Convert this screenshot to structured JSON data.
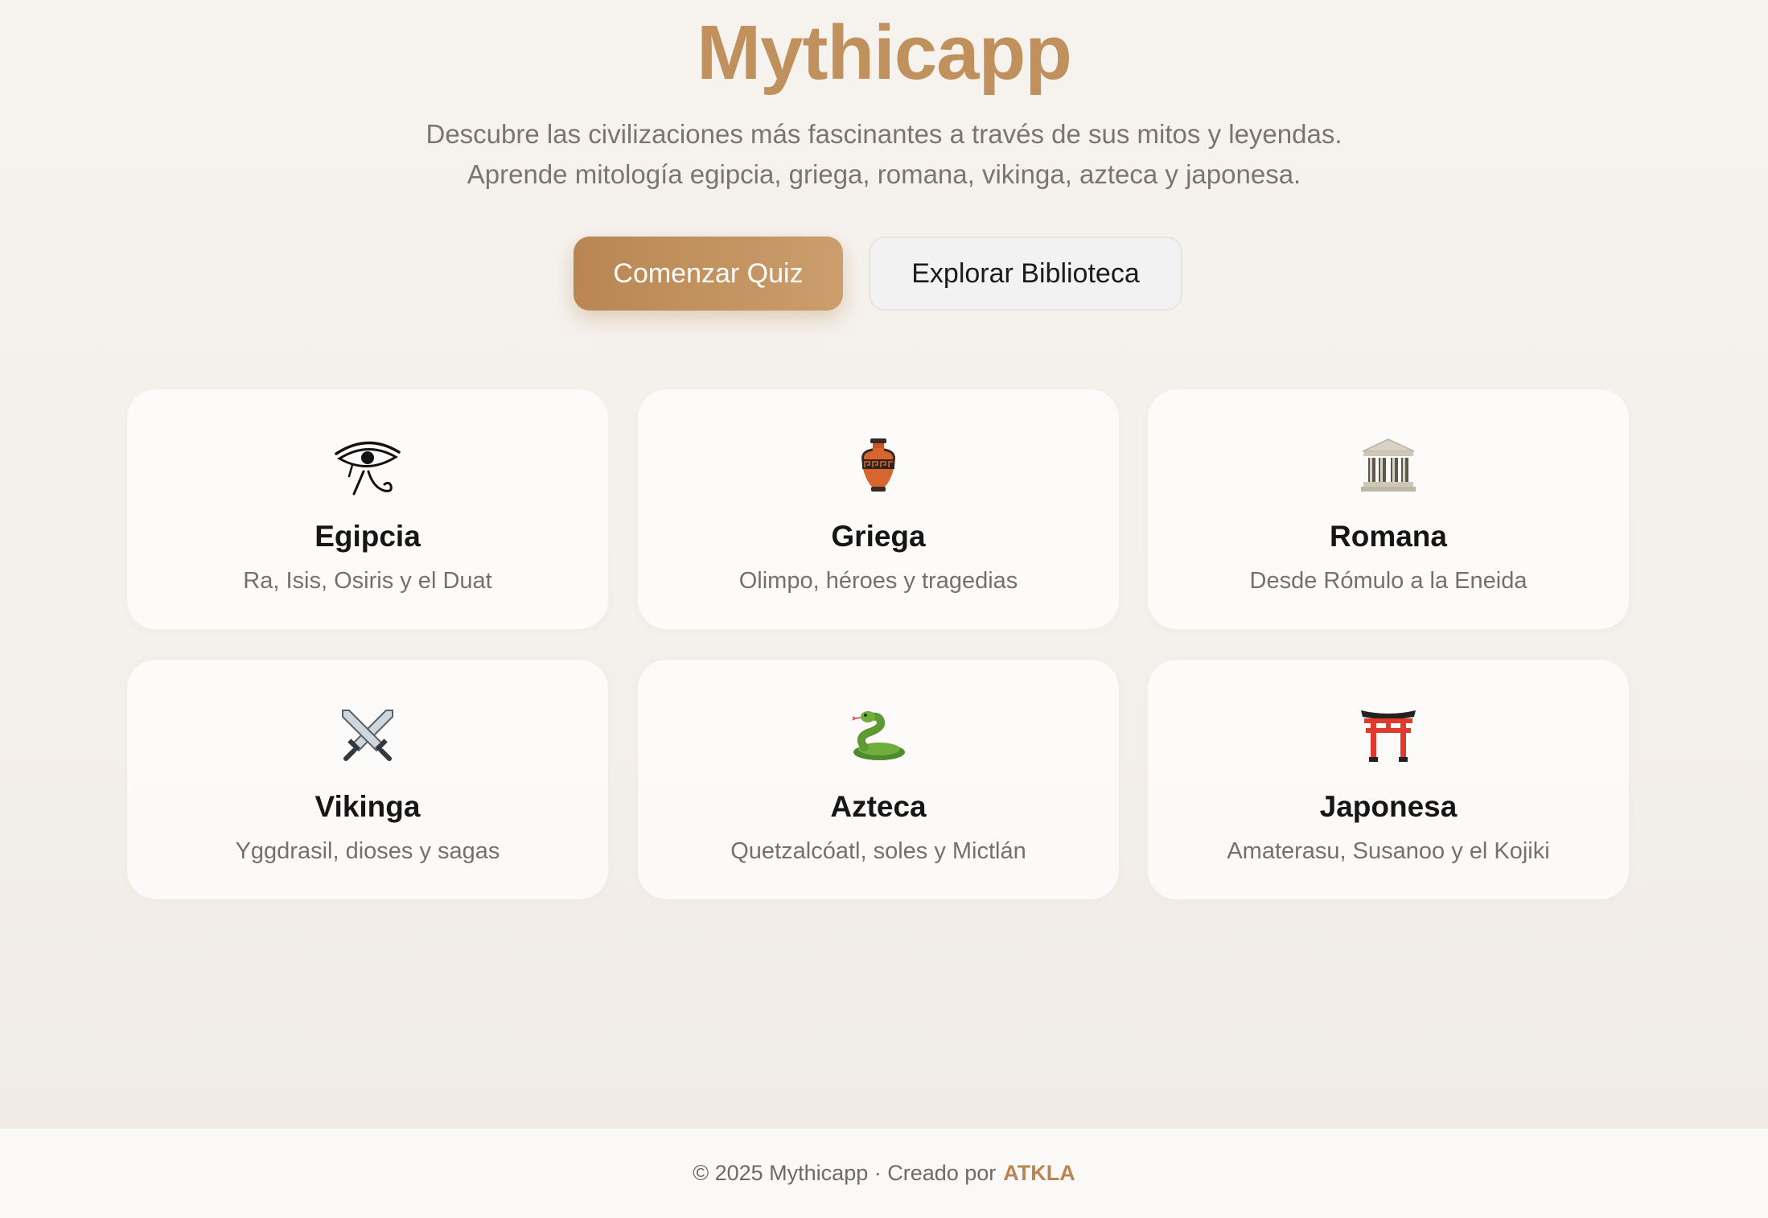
{
  "header": {
    "title": "Mythicapp",
    "tagline_line1": "Descubre las civilizaciones más fascinantes a través de sus mitos y leyendas.",
    "tagline_line2": "Aprende mitología egipcia, griega, romana, vikinga, azteca y japonesa."
  },
  "actions": {
    "primary_label": "Comenzar Quiz",
    "secondary_label": "Explorar Biblioteca"
  },
  "civilizations": [
    {
      "icon": "eye-of-horus-icon",
      "name": "Egipcia",
      "description": "Ra, Isis, Osiris y el Duat"
    },
    {
      "icon": "amphora-icon",
      "name": "Griega",
      "description": "Olimpo, héroes y tragedias"
    },
    {
      "icon": "classical-building-icon",
      "name": "Romana",
      "description": "Desde Rómulo a la Eneida"
    },
    {
      "icon": "crossed-swords-icon",
      "name": "Vikinga",
      "description": "Yggdrasil, dioses y sagas"
    },
    {
      "icon": "snake-icon",
      "name": "Azteca",
      "description": "Quetzalcóatl, soles y Mictlán"
    },
    {
      "icon": "torii-gate-icon",
      "name": "Japonesa",
      "description": "Amaterasu, Susanoo y el Kojiki"
    }
  ],
  "footer": {
    "copyright": "© 2025 Mythicapp · Creado por",
    "author": "ATKLA"
  },
  "colors": {
    "brand": "#c0915d",
    "primary_button": "#c0915d",
    "text_muted": "#74716d"
  }
}
